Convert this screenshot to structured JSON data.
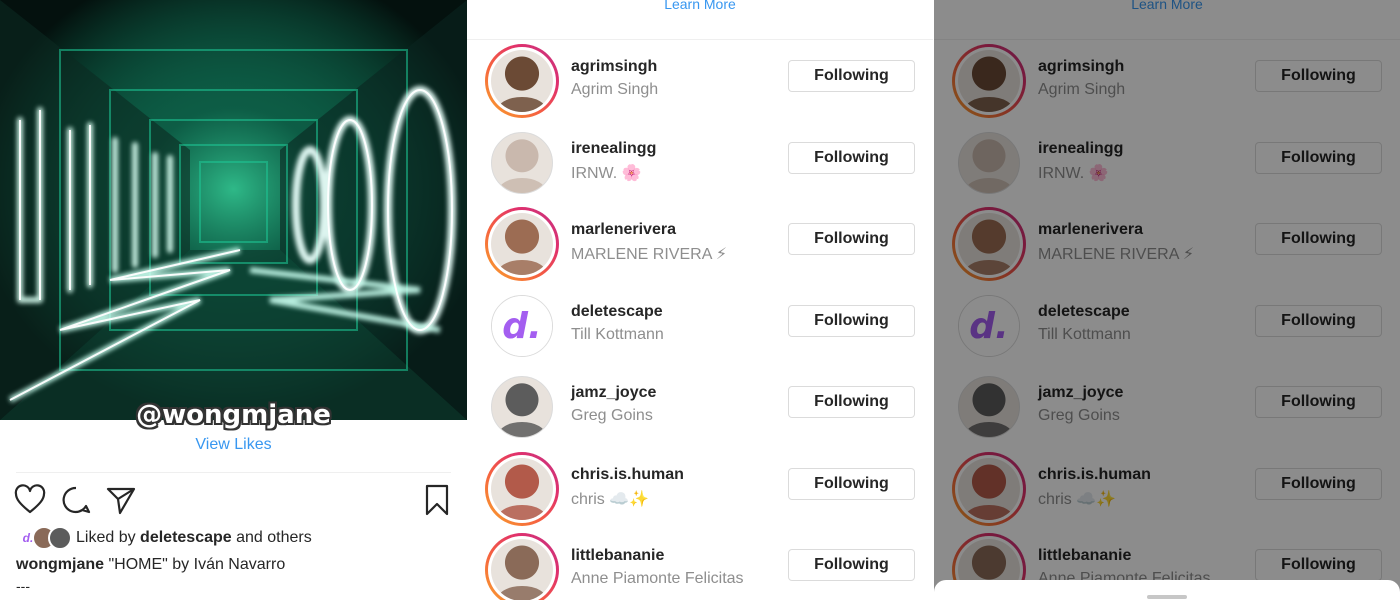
{
  "post": {
    "watermark": "@wongmjane",
    "view_likes": "View Likes",
    "liked_prefix": "Liked by",
    "liked_user": "deletescape",
    "liked_suffix": "and others",
    "caption_user": "wongmjane",
    "caption_text": "\"HOME\" by Iván Navarro",
    "caption_more": "---",
    "mini_avatar_letter": "d."
  },
  "list": {
    "learn_more": "Learn More",
    "button_label": "Following",
    "users": [
      {
        "username": "agrimsingh",
        "fullname": "Agrim Singh",
        "story": true,
        "avatar_color": "#6b4a35"
      },
      {
        "username": "irenealingg",
        "fullname": "IRNW. 🌸",
        "story": false,
        "avatar_color": "#c9b8ad"
      },
      {
        "username": "marlenerivera",
        "fullname": "MARLENE RIVERA ⚡",
        "story": true,
        "avatar_color": "#9c6c53"
      },
      {
        "username": "deletescape",
        "fullname": "Till Kottmann",
        "story": false,
        "avatar_letter": "d."
      },
      {
        "username": "jamz_joyce",
        "fullname": "Greg Goins",
        "story": false,
        "avatar_color": "#5c5c5c"
      },
      {
        "username": "chris.is.human",
        "fullname": "chris ☁️✨",
        "story": true,
        "avatar_color": "#b25a4a"
      },
      {
        "username": "littlebananie",
        "fullname": "Anne Piamonte Felicitas",
        "story": true,
        "avatar_color": "#8a6a58"
      }
    ]
  },
  "colors": {
    "link_blue": "#3897f0",
    "text_dark": "#262626",
    "text_gray": "#8e8e8e",
    "border": "#dbdbdb",
    "neon_green": "#2fe0a2",
    "deletescape_purple": "#a45ef0"
  }
}
